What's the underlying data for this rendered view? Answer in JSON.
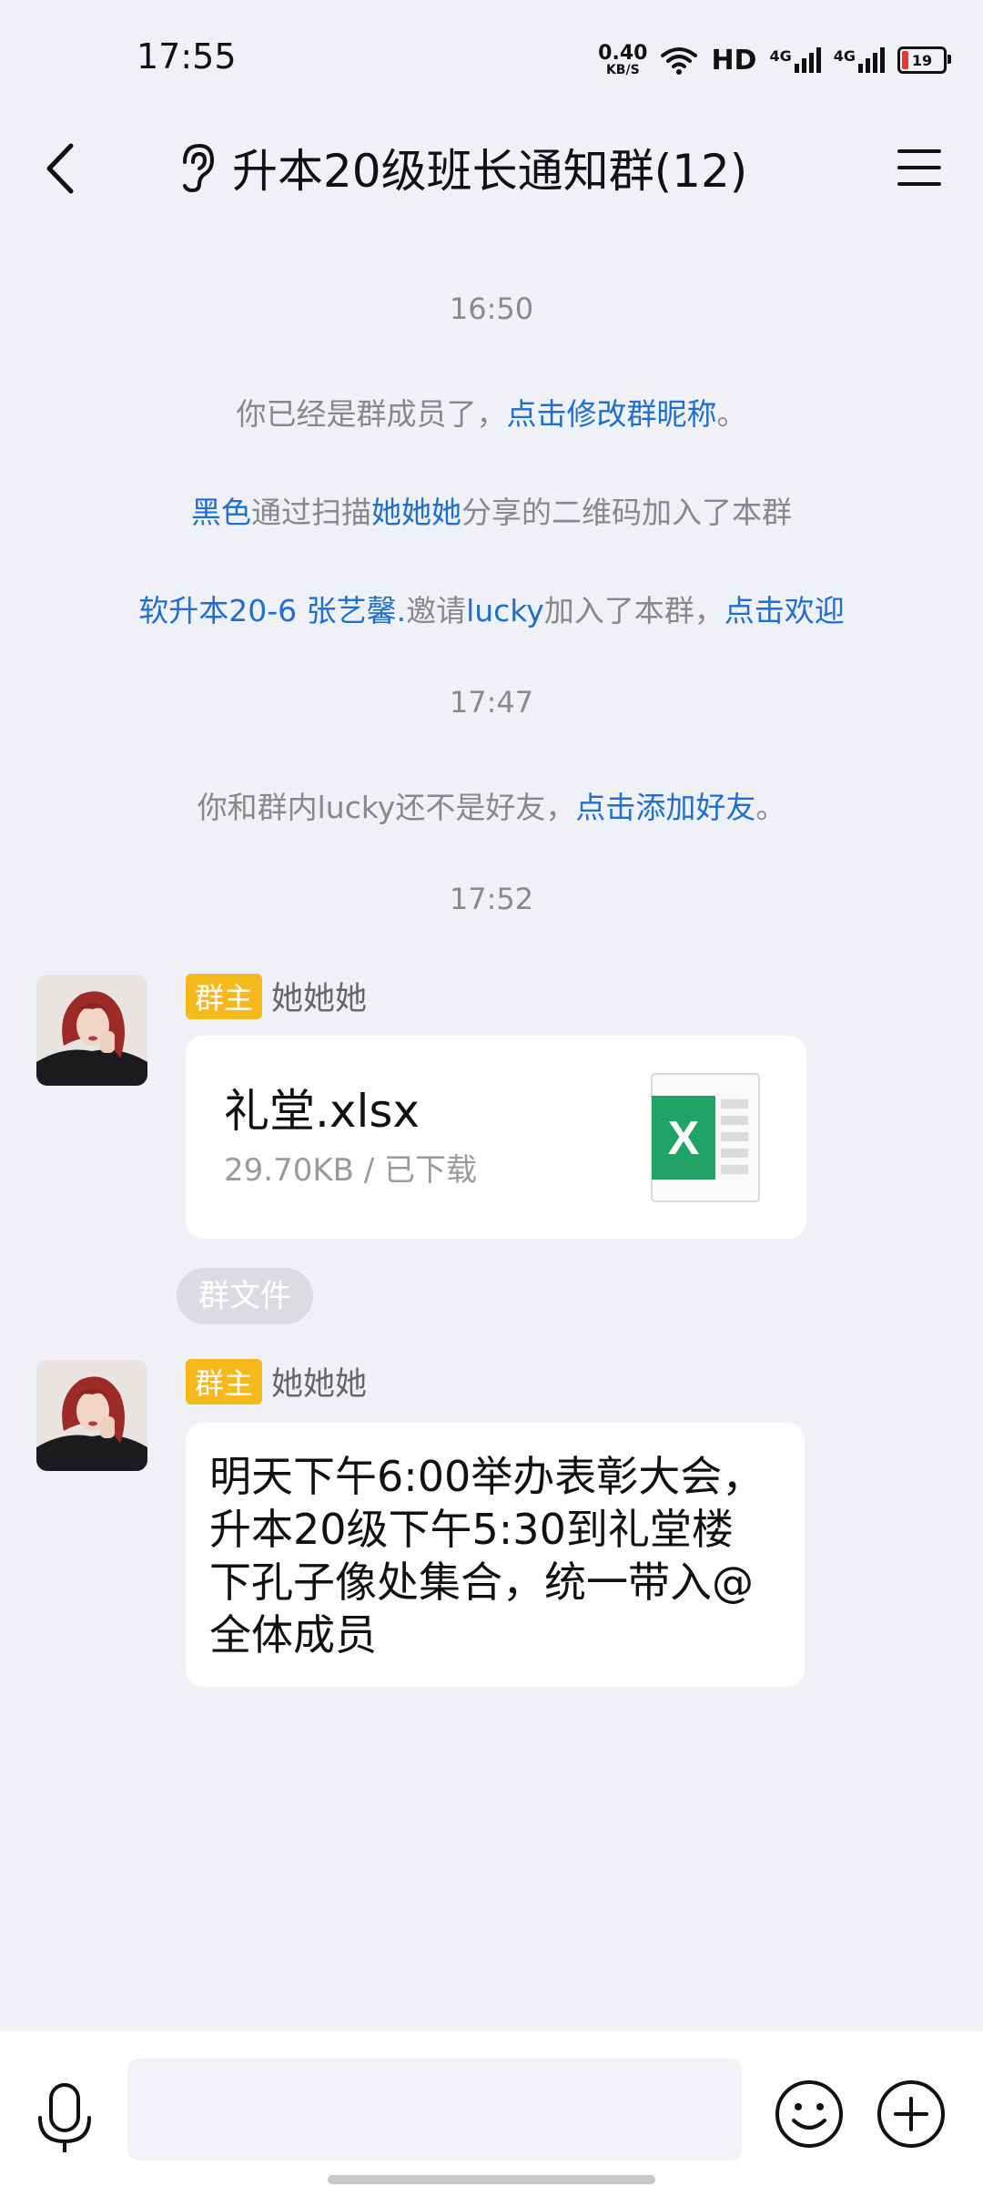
{
  "status_bar": {
    "time": "17:55",
    "net_speed_value": "0.40",
    "net_speed_unit": "KB/S",
    "hd": "HD",
    "network_1": "4G",
    "network_2": "4G",
    "battery": "19",
    "battery_level_percent": 19
  },
  "header": {
    "title": "升本20级班长通知群(12)"
  },
  "messages": {
    "time_1": "16:50",
    "sys_1_text": "你已经是群成员了，",
    "sys_1_link": "点击修改群昵称",
    "sys_1_end": "。",
    "sys_2_name": "黑色",
    "sys_2_text_a": "通过扫描",
    "sys_2_name_2": "她她她",
    "sys_2_text_b": "分享的二维码加入了本群",
    "sys_3_name": "软升本20-6 张艺馨.",
    "sys_3_text_a": "邀请",
    "sys_3_name_2": "lucky",
    "sys_3_text_b": "加入了本群，",
    "sys_3_link": "点击欢迎",
    "time_2": "17:47",
    "sys_4_text": "你和群内lucky还不是好友，",
    "sys_4_link": "点击添加好友",
    "sys_4_end": "。",
    "time_3": "17:52"
  },
  "msg_file": {
    "badge": "群主",
    "sender": "她她她",
    "file_name": "礼堂.xlsx",
    "file_meta": "29.70KB / 已下载",
    "chip": "群文件"
  },
  "msg_text": {
    "badge": "群主",
    "sender": "她她她",
    "text": "明天下午6:00举办表彰大会，升本20级下午5:30到礼堂楼下孔子像处集合，统一带入@全体成员"
  },
  "colors": {
    "link": "#1e6fd0",
    "badge": "#f5b91c",
    "excel_green": "#21a366"
  }
}
